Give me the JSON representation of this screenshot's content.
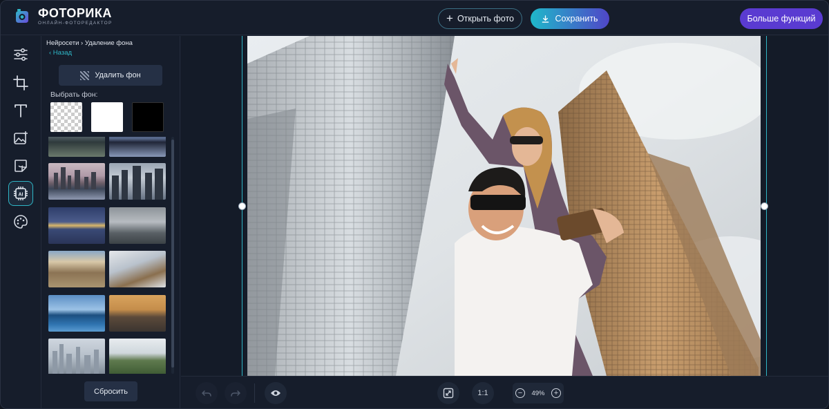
{
  "header": {
    "logo_title": "ФОТОРИКА",
    "logo_subtitle": "ОНЛАЙН-ФОТОРЕДАКТОР",
    "open_label": "Открыть фото",
    "save_label": "Сохранить",
    "more_label": "Больше функций"
  },
  "toolbar": {
    "items": [
      {
        "name": "adjust-icon",
        "active": false
      },
      {
        "name": "crop-icon",
        "active": false
      },
      {
        "name": "text-icon",
        "active": false
      },
      {
        "name": "add-image-icon",
        "active": false
      },
      {
        "name": "sticker-icon",
        "active": false
      },
      {
        "name": "ai-chip-icon",
        "active": true,
        "label": "AI"
      },
      {
        "name": "palette-icon",
        "active": false
      }
    ]
  },
  "panel": {
    "breadcrumb": "Нейросети › Удаление фона",
    "back_label": "‹ Назад",
    "remove_bg_label": "Удалить фон",
    "choose_bg_label": "Выбрать фон:",
    "swatches": [
      "transparent",
      "#ffffff",
      "#000000"
    ],
    "reset_label": "Сбросить"
  },
  "canvas": {
    "zoom": "49%"
  },
  "bottom": {
    "ratio_label": "1:1"
  },
  "colors": {
    "accent": "#2fb7c7",
    "purple": "#5a3bd1",
    "bg": "#161d2b"
  }
}
